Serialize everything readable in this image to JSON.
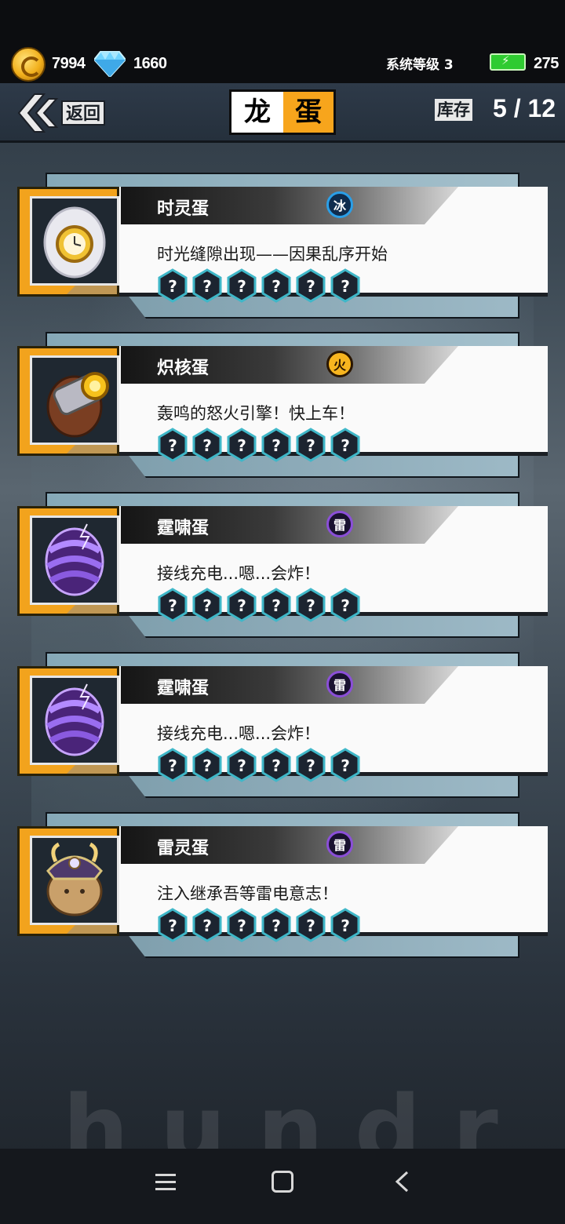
{
  "status_bar": {
    "coins": "7994",
    "gems": "1660",
    "system_level": "系统等级 3",
    "energy": "275"
  },
  "header": {
    "back_label": "返回",
    "title_left": "龙",
    "title_right": "蛋",
    "inventory_label": "库存",
    "inventory_count": "5 / 12"
  },
  "background_watermark": "hundr",
  "eggs": [
    {
      "name": "时灵蛋",
      "element": "冰",
      "element_color": "#2a9fe8",
      "description": "时光缝隙出现——因果乱序开始",
      "egg_icon": "clock-egg-icon",
      "stars": [
        "?",
        "?",
        "?",
        "?",
        "?",
        "?"
      ]
    },
    {
      "name": "炽核蛋",
      "element": "火",
      "element_color": "#f0a21a",
      "description": "轰鸣的怒火引擎！快上车！",
      "egg_icon": "engine-egg-icon",
      "stars": [
        "?",
        "?",
        "?",
        "?",
        "?",
        "?"
      ]
    },
    {
      "name": "霆啸蛋",
      "element": "雷",
      "element_color": "#8b4fd8",
      "description": "接线充电...嗯...会炸！",
      "egg_icon": "thunder-egg-icon",
      "stars": [
        "?",
        "?",
        "?",
        "?",
        "?",
        "?"
      ]
    },
    {
      "name": "霆啸蛋",
      "element": "雷",
      "element_color": "#8b4fd8",
      "description": "接线充电...嗯...会炸！",
      "egg_icon": "thunder-egg-icon",
      "stars": [
        "?",
        "?",
        "?",
        "?",
        "?",
        "?"
      ]
    },
    {
      "name": "雷灵蛋",
      "element": "雷",
      "element_color": "#8b4fd8",
      "description": "注入继承吾等雷电意志！",
      "egg_icon": "samurai-egg-icon",
      "stars": [
        "?",
        "?",
        "?",
        "?",
        "?",
        "?"
      ]
    }
  ],
  "colors": {
    "accent_orange": "#f2a31d",
    "star_slot_fill": "#1c2430",
    "star_slot_border": "#3fb7c8"
  }
}
